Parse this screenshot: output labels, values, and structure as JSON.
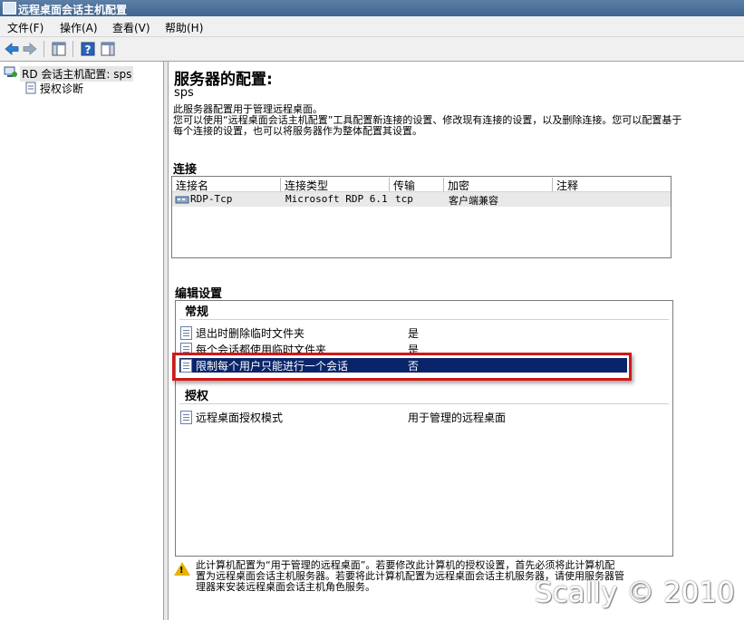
{
  "window": {
    "title": "远程桌面会话主机配置"
  },
  "menu": {
    "file": "文件(F)",
    "action": "操作(A)",
    "view": "查看(V)",
    "help": "帮助(H)"
  },
  "tree": {
    "root": "RD 会话主机配置: sps",
    "child": "授权诊断"
  },
  "main": {
    "heading": "服务器的配置:",
    "server_name": "sps",
    "desc_line1": "此服务器配置用于管理远程桌面。",
    "desc_line2": "您可以使用“远程桌面会话主机配置”工具配置新连接的设置、修改现有连接的设置，以及删除连接。您可以配置基于",
    "desc_line3": "每个连接的设置，也可以将服务器作为整体配置其设置。"
  },
  "connections": {
    "title": "连接",
    "columns": [
      "连接名",
      "连接类型",
      "传输",
      "加密",
      "注释"
    ],
    "rows": [
      {
        "name": "RDP-Tcp",
        "type": "Microsoft RDP 6.1",
        "transport": "tcp",
        "encryption": "客户端兼容",
        "comment": ""
      }
    ]
  },
  "settings": {
    "title": "编辑设置",
    "general": {
      "header": "常规",
      "items": [
        {
          "label": "退出时删除临时文件夹",
          "value": "是"
        },
        {
          "label": "每个会话都使用临时文件夹",
          "value": "是"
        },
        {
          "label": "限制每个用户只能进行一个会话",
          "value": "否"
        }
      ]
    },
    "licensing": {
      "header": "授权",
      "items": [
        {
          "label": "远程桌面授权模式",
          "value": "用于管理的远程桌面"
        }
      ]
    }
  },
  "warning": {
    "line1": "此计算机配置为“用于管理的远程桌面”。若要修改此计算机的授权设置，首先必须将此计算机配",
    "line2": "置为远程桌面会话主机服务器。若要将此计算机配置为远程桌面会话主机服务器，请使用服务器管",
    "line3": "理器来安装远程桌面会话主机角色服务。"
  },
  "watermark": "Scally © 2010",
  "colors": {
    "selection": "#0a246a",
    "highlight_border": "#d01818",
    "titlebar": "#3e6590"
  }
}
